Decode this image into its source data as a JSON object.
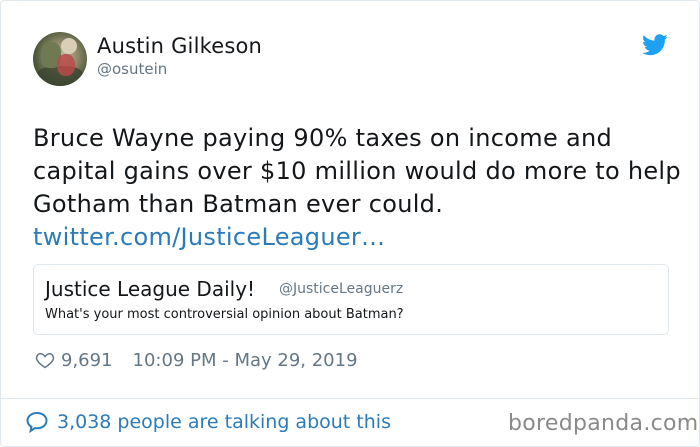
{
  "user": {
    "name": "Austin Gilkeson",
    "handle": "@osutein"
  },
  "tweet": {
    "lines": [
      "Bruce Wayne paying 90% taxes on income and",
      "capital gains over $10 million would do more to help",
      "Gotham than Batman ever could."
    ],
    "link": "twitter.com/JusticeLeaguer…"
  },
  "quoted_tweet": {
    "name": "Justice League Daily!",
    "handle": "@JusticeLeaguerz",
    "text": "What's your most controversial opinion about Batman?"
  },
  "meta": {
    "likes": "9,691",
    "timestamp": "10:09 PM - May 29, 2019"
  },
  "footer": {
    "talking": "3,038 people are talking about this"
  },
  "watermark": "boredpanda.com",
  "colors": {
    "link": "#2b7bb9",
    "twitter_blue": "#1da1f2",
    "secondary_text": "#657786",
    "border": "#e1e8ed"
  },
  "icons": [
    "twitter-bird-icon",
    "heart-icon",
    "speech-bubble-icon"
  ]
}
